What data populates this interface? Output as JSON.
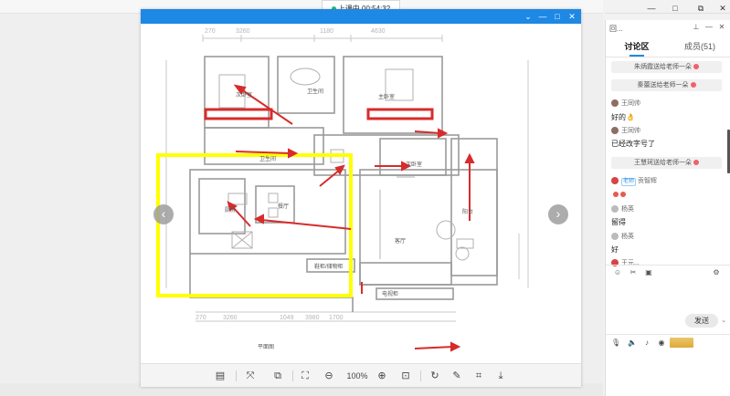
{
  "live": {
    "status": "上课中",
    "elapsed": "00:54:32"
  },
  "viewer": {
    "zoom": "100%",
    "plan_labels": [
      "次卧室",
      "卫生间",
      "主卧室",
      "卫生间",
      "厨房",
      "餐厅",
      "次卧室",
      "客厅",
      "阳台",
      "鞋柜/储物柜",
      "电视柜",
      "平面图"
    ],
    "dimensions": [
      "270",
      "3260",
      "1180",
      "4630",
      "270",
      "3260",
      "1049",
      "3980",
      "1700"
    ]
  },
  "panel": {
    "title": "回...",
    "tabs": [
      {
        "label": "讨论区"
      },
      {
        "label": "成员(51)"
      }
    ],
    "messages": {
      "sys1": "朱炳霞送给老师一朵",
      "sys2": "秦蕾送给老师一朵",
      "user1": "王同帅",
      "text1": "好的👌",
      "user2": "王同帅",
      "text2": "已经改字号了",
      "sys3": "王慧珂送给老师一朵",
      "role": "老师",
      "user3": "贡智辉",
      "user4": "杨英",
      "text4": "留得",
      "user5": "杨英",
      "text5": "好",
      "user6": "王元..."
    },
    "send_label": "发送"
  },
  "icons": {
    "pin": "pin-icon",
    "minimize": "minimize-icon",
    "close": "close-icon",
    "prev": "chevron-left-icon",
    "next": "chevron-right-icon"
  },
  "colors": {
    "accent": "#1e88e5",
    "highlight_box": "#ffff00",
    "markup_red": "#d82b2b"
  }
}
